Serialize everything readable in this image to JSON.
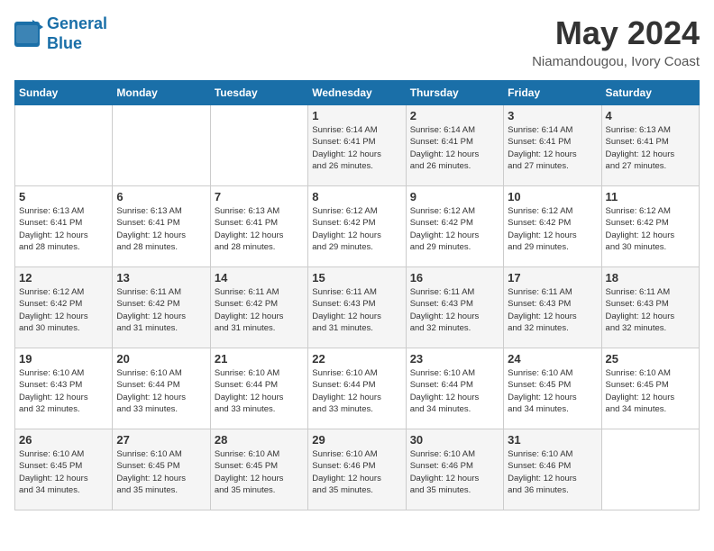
{
  "logo": {
    "line1": "General",
    "line2": "Blue"
  },
  "title": "May 2024",
  "location": "Niamandougou, Ivory Coast",
  "days_header": [
    "Sunday",
    "Monday",
    "Tuesday",
    "Wednesday",
    "Thursday",
    "Friday",
    "Saturday"
  ],
  "weeks": [
    [
      {
        "day": "",
        "info": ""
      },
      {
        "day": "",
        "info": ""
      },
      {
        "day": "",
        "info": ""
      },
      {
        "day": "1",
        "info": "Sunrise: 6:14 AM\nSunset: 6:41 PM\nDaylight: 12 hours\nand 26 minutes."
      },
      {
        "day": "2",
        "info": "Sunrise: 6:14 AM\nSunset: 6:41 PM\nDaylight: 12 hours\nand 26 minutes."
      },
      {
        "day": "3",
        "info": "Sunrise: 6:14 AM\nSunset: 6:41 PM\nDaylight: 12 hours\nand 27 minutes."
      },
      {
        "day": "4",
        "info": "Sunrise: 6:13 AM\nSunset: 6:41 PM\nDaylight: 12 hours\nand 27 minutes."
      }
    ],
    [
      {
        "day": "5",
        "info": "Sunrise: 6:13 AM\nSunset: 6:41 PM\nDaylight: 12 hours\nand 28 minutes."
      },
      {
        "day": "6",
        "info": "Sunrise: 6:13 AM\nSunset: 6:41 PM\nDaylight: 12 hours\nand 28 minutes."
      },
      {
        "day": "7",
        "info": "Sunrise: 6:13 AM\nSunset: 6:41 PM\nDaylight: 12 hours\nand 28 minutes."
      },
      {
        "day": "8",
        "info": "Sunrise: 6:12 AM\nSunset: 6:42 PM\nDaylight: 12 hours\nand 29 minutes."
      },
      {
        "day": "9",
        "info": "Sunrise: 6:12 AM\nSunset: 6:42 PM\nDaylight: 12 hours\nand 29 minutes."
      },
      {
        "day": "10",
        "info": "Sunrise: 6:12 AM\nSunset: 6:42 PM\nDaylight: 12 hours\nand 29 minutes."
      },
      {
        "day": "11",
        "info": "Sunrise: 6:12 AM\nSunset: 6:42 PM\nDaylight: 12 hours\nand 30 minutes."
      }
    ],
    [
      {
        "day": "12",
        "info": "Sunrise: 6:12 AM\nSunset: 6:42 PM\nDaylight: 12 hours\nand 30 minutes."
      },
      {
        "day": "13",
        "info": "Sunrise: 6:11 AM\nSunset: 6:42 PM\nDaylight: 12 hours\nand 31 minutes."
      },
      {
        "day": "14",
        "info": "Sunrise: 6:11 AM\nSunset: 6:42 PM\nDaylight: 12 hours\nand 31 minutes."
      },
      {
        "day": "15",
        "info": "Sunrise: 6:11 AM\nSunset: 6:43 PM\nDaylight: 12 hours\nand 31 minutes."
      },
      {
        "day": "16",
        "info": "Sunrise: 6:11 AM\nSunset: 6:43 PM\nDaylight: 12 hours\nand 32 minutes."
      },
      {
        "day": "17",
        "info": "Sunrise: 6:11 AM\nSunset: 6:43 PM\nDaylight: 12 hours\nand 32 minutes."
      },
      {
        "day": "18",
        "info": "Sunrise: 6:11 AM\nSunset: 6:43 PM\nDaylight: 12 hours\nand 32 minutes."
      }
    ],
    [
      {
        "day": "19",
        "info": "Sunrise: 6:10 AM\nSunset: 6:43 PM\nDaylight: 12 hours\nand 32 minutes."
      },
      {
        "day": "20",
        "info": "Sunrise: 6:10 AM\nSunset: 6:44 PM\nDaylight: 12 hours\nand 33 minutes."
      },
      {
        "day": "21",
        "info": "Sunrise: 6:10 AM\nSunset: 6:44 PM\nDaylight: 12 hours\nand 33 minutes."
      },
      {
        "day": "22",
        "info": "Sunrise: 6:10 AM\nSunset: 6:44 PM\nDaylight: 12 hours\nand 33 minutes."
      },
      {
        "day": "23",
        "info": "Sunrise: 6:10 AM\nSunset: 6:44 PM\nDaylight: 12 hours\nand 34 minutes."
      },
      {
        "day": "24",
        "info": "Sunrise: 6:10 AM\nSunset: 6:45 PM\nDaylight: 12 hours\nand 34 minutes."
      },
      {
        "day": "25",
        "info": "Sunrise: 6:10 AM\nSunset: 6:45 PM\nDaylight: 12 hours\nand 34 minutes."
      }
    ],
    [
      {
        "day": "26",
        "info": "Sunrise: 6:10 AM\nSunset: 6:45 PM\nDaylight: 12 hours\nand 34 minutes."
      },
      {
        "day": "27",
        "info": "Sunrise: 6:10 AM\nSunset: 6:45 PM\nDaylight: 12 hours\nand 35 minutes."
      },
      {
        "day": "28",
        "info": "Sunrise: 6:10 AM\nSunset: 6:45 PM\nDaylight: 12 hours\nand 35 minutes."
      },
      {
        "day": "29",
        "info": "Sunrise: 6:10 AM\nSunset: 6:46 PM\nDaylight: 12 hours\nand 35 minutes."
      },
      {
        "day": "30",
        "info": "Sunrise: 6:10 AM\nSunset: 6:46 PM\nDaylight: 12 hours\nand 35 minutes."
      },
      {
        "day": "31",
        "info": "Sunrise: 6:10 AM\nSunset: 6:46 PM\nDaylight: 12 hours\nand 36 minutes."
      },
      {
        "day": "",
        "info": ""
      }
    ]
  ]
}
